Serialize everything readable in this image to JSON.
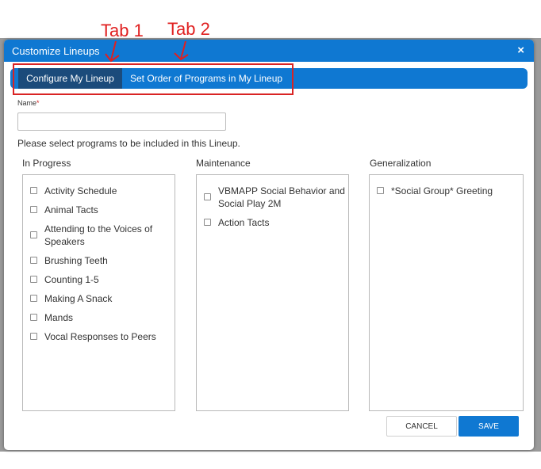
{
  "dialog": {
    "title": "Customize Lineups",
    "close_glyph": "×"
  },
  "tabs": [
    {
      "label": "Configure My Lineup",
      "active": true
    },
    {
      "label": "Set Order of Programs in My Lineup",
      "active": false
    }
  ],
  "form": {
    "name_label": "Name",
    "required_mark": "*",
    "name_value": "",
    "instruction": "Please select programs to be included in this Lineup."
  },
  "columns": [
    {
      "title": "In Progress",
      "items": [
        "Activity Schedule",
        "Animal Tacts",
        "Attending to the Voices of Speakers",
        "Brushing Teeth",
        "Counting 1-5",
        "Making A Snack",
        "Mands",
        "Vocal Responses to Peers"
      ]
    },
    {
      "title": "Maintenance",
      "items": [
        "VBMAPP Social Behavior and Social Play 2M",
        "Action Tacts"
      ]
    },
    {
      "title": "Generalization",
      "items": [
        "*Social Group* Greeting"
      ]
    }
  ],
  "buttons": {
    "cancel": "CANCEL",
    "save": "SAVE"
  },
  "annotations": {
    "tab1": "Tab 1",
    "tab2": "Tab 2",
    "color": "#e02020"
  },
  "colors": {
    "accent": "#0f78d2",
    "active_tab": "#1b4b7b"
  }
}
